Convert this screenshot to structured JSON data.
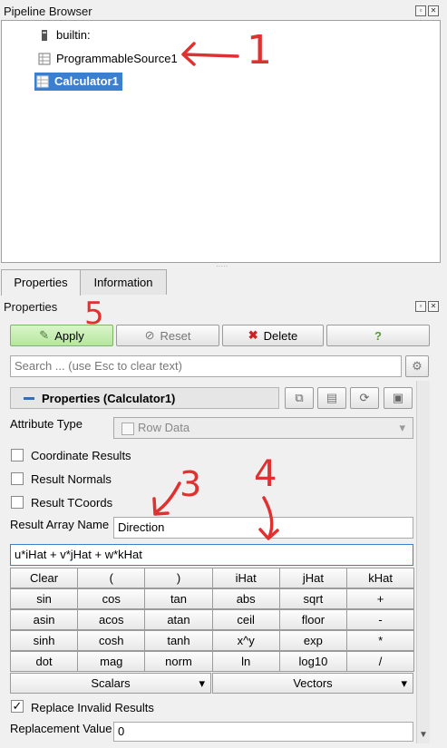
{
  "pipeline": {
    "title": "Pipeline Browser",
    "items": [
      {
        "label": "builtin:"
      },
      {
        "label": "ProgrammableSource1"
      },
      {
        "label": "Calculator1",
        "selected": true
      }
    ]
  },
  "tabs": [
    {
      "label": "Properties"
    },
    {
      "label": "Information"
    }
  ],
  "properties_panel": {
    "title": "Properties",
    "buttons": {
      "apply": "Apply",
      "reset": "Reset",
      "delete": "Delete",
      "help": "?"
    },
    "search_placeholder": "Search ... (use Esc to clear text)",
    "section_title": "Properties (Calculator1)",
    "attribute_type_label": "Attribute Type",
    "attribute_type_value": "Row Data",
    "checkboxes": [
      {
        "label": "Coordinate Results",
        "checked": false
      },
      {
        "label": "Result Normals",
        "checked": false
      },
      {
        "label": "Result TCoords",
        "checked": false
      }
    ],
    "result_array_name_label": "Result Array Name",
    "result_array_name_value": "Direction",
    "expression": "u*iHat + v*jHat + w*kHat",
    "calc_rows": [
      [
        "Clear",
        "(",
        ")",
        "iHat",
        "jHat",
        "kHat"
      ],
      [
        "sin",
        "cos",
        "tan",
        "abs",
        "sqrt",
        "+"
      ],
      [
        "asin",
        "acos",
        "atan",
        "ceil",
        "floor",
        "-"
      ],
      [
        "sinh",
        "cosh",
        "tanh",
        "x^y",
        "exp",
        "*"
      ],
      [
        "dot",
        "mag",
        "norm",
        "ln",
        "log10",
        "/"
      ]
    ],
    "scalars_label": "Scalars",
    "vectors_label": "Vectors",
    "replace_invalid_label": "Replace Invalid Results",
    "replace_invalid_checked": true,
    "replacement_value_label": "Replacement Value",
    "replacement_value": "0"
  },
  "annotations": [
    "1",
    "3",
    "4",
    "5"
  ],
  "colors": {
    "selection": "#3a7fd0",
    "annotation": "#e03030",
    "apply": "#b6e6a0"
  }
}
